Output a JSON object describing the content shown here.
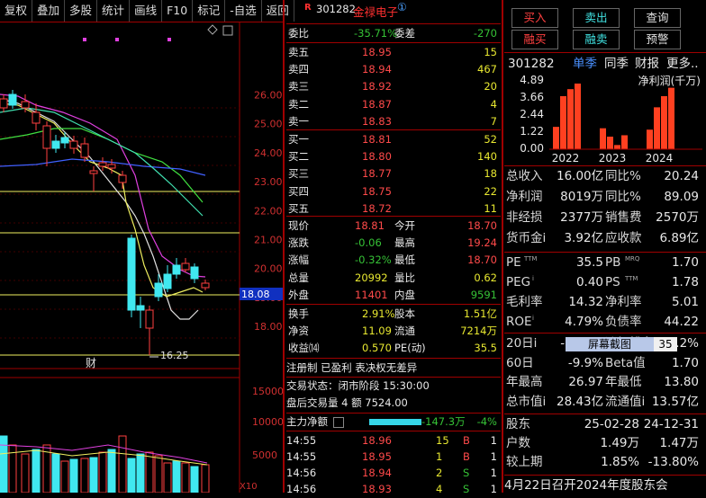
{
  "toolbar": {
    "items": [
      "复权",
      "叠加",
      "多股",
      "统计",
      "画线",
      "F10",
      "标记",
      "-自选",
      "返回"
    ]
  },
  "chart": {
    "y_ticks": [
      "26.00",
      "25.00",
      "24.00",
      "23.00",
      "22.00",
      "21.00",
      "20.00",
      "19.00",
      "18.00"
    ],
    "current_price_tag": "18.08",
    "low_label": "16.25",
    "finance_marker": "财",
    "volume_ticks": [
      "15000",
      "10000",
      "5000"
    ],
    "volume_unit": "X10"
  },
  "quote": {
    "badge": "R",
    "code": "301282",
    "name": "金禄电子",
    "info_icon": "①",
    "webi_label": "委比",
    "webi_value": "-35.71%",
    "weicha_label": "委差",
    "weicha_value": "-270",
    "asks": [
      {
        "label": "卖五",
        "price": "18.95",
        "vol": "15"
      },
      {
        "label": "卖四",
        "price": "18.94",
        "vol": "467"
      },
      {
        "label": "卖三",
        "price": "18.92",
        "vol": "20"
      },
      {
        "label": "卖二",
        "price": "18.87",
        "vol": "4"
      },
      {
        "label": "卖一",
        "price": "18.83",
        "vol": "7"
      }
    ],
    "bids": [
      {
        "label": "买一",
        "price": "18.81",
        "vol": "52"
      },
      {
        "label": "买二",
        "price": "18.80",
        "vol": "140"
      },
      {
        "label": "买三",
        "price": "18.77",
        "vol": "18"
      },
      {
        "label": "买四",
        "price": "18.75",
        "vol": "22"
      },
      {
        "label": "买五",
        "price": "18.72",
        "vol": "11"
      }
    ],
    "stats": [
      {
        "l1": "现价",
        "v1": "18.81",
        "l2": "今开",
        "v2": "18.70"
      },
      {
        "l1": "涨跌",
        "v1": "-0.06",
        "l2": "最高",
        "v2": "19.24"
      },
      {
        "l1": "涨幅",
        "v1": "-0.32%",
        "l2": "最低",
        "v2": "18.70"
      },
      {
        "l1": "总量",
        "v1": "20992",
        "l2": "量比",
        "v2": "0.62"
      },
      {
        "l1": "外盘",
        "v1": "11401",
        "l2": "内盘",
        "v2": "9591"
      }
    ],
    "stats2": [
      {
        "l1": "换手",
        "v1": "2.91%",
        "l2": "股本",
        "v2": "1.51亿"
      },
      {
        "l1": "净资",
        "v1": "11.09",
        "l2": "流通",
        "v2": "7214万"
      },
      {
        "l1": "收益⒁",
        "v1": "0.570",
        "l2": "PE(动)",
        "v2": "35.5"
      }
    ],
    "tags": "注册制 已盈利 表决权无差异",
    "trade_status": "交易状态：闭市阶段 15:30:00",
    "after_hours": "盘后交易量 4 额 7524.00",
    "main_flow_label": "主力净额",
    "main_flow_value": "-147.3万",
    "main_flow_pct": "-4%",
    "ticks": [
      {
        "time": "14:55",
        "price": "18.96",
        "vol": "15",
        "side": "B",
        "n": "1"
      },
      {
        "time": "14:55",
        "price": "18.95",
        "vol": "1",
        "side": "B",
        "n": "1"
      },
      {
        "time": "14:56",
        "price": "18.94",
        "vol": "2",
        "side": "S",
        "n": "1"
      },
      {
        "time": "14:56",
        "price": "18.93",
        "vol": "4",
        "side": "S",
        "n": "1"
      }
    ]
  },
  "right": {
    "buttons": [
      "买入",
      "卖出",
      "查询",
      "融买",
      "融卖",
      "预警"
    ],
    "code": "301282",
    "tabs": [
      "单季",
      "同季",
      "财报",
      "更多.."
    ],
    "chart_title": "净利润(千万)",
    "chart_data": {
      "type": "bar",
      "y_ticks": [
        "4.89",
        "3.66",
        "2.44",
        "1.22",
        "0.00"
      ],
      "ylim": [
        0,
        4.89
      ],
      "x_labels": [
        "2022",
        "2023",
        "2024"
      ],
      "values": [
        1.6,
        3.8,
        4.3,
        4.7,
        1.5,
        0.9,
        0.3,
        1.0,
        1.4,
        3.0,
        3.8,
        4.4
      ]
    },
    "metrics1": [
      {
        "l1": "总收入",
        "v1": "16.00亿",
        "l2": "同比%",
        "v2": "20.24"
      },
      {
        "l1": "净利润",
        "v1": "8019万",
        "l2": "同比%",
        "v2": "89.09"
      },
      {
        "l1": "非经损",
        "v1": "2377万",
        "l2": "销售费",
        "v2": "2570万"
      },
      {
        "l1": "货币金i",
        "v1": "3.92亿",
        "l2": "应收款",
        "v2": "6.89亿"
      }
    ],
    "metrics2": [
      {
        "l1": "PE",
        "sup1": "TTM",
        "v1": "35.5",
        "l2": "PB",
        "sup2": "MRQ",
        "v2": "1.70"
      },
      {
        "l1": "PEG",
        "sup1": "i",
        "v1": "0.40",
        "l2": "PS",
        "sup2": "TTM",
        "v2": "1.78"
      },
      {
        "l1": "毛利率",
        "sup1": "",
        "v1": "14.32",
        "l2": "净利率",
        "sup2": "",
        "v2": "5.01"
      },
      {
        "l1": "ROE",
        "sup1": "i",
        "v1": "4.79%",
        "l2": "负债率",
        "sup2": "",
        "v2": "44.22"
      }
    ],
    "perf": [
      {
        "l1": "20日i",
        "v1": "-23.9%",
        "l2": "涨幅排名",
        "v2": "-10.2%"
      },
      {
        "l1": "60日",
        "v1": "-9.9%",
        "l2": "Beta值",
        "v2": "1.70"
      },
      {
        "l1": "年最高",
        "v1": "26.97",
        "l2": "年最低",
        "v2": "13.80"
      },
      {
        "l1": "总市值i",
        "v1": "28.43亿",
        "l2": "流通值i",
        "v2": "13.57亿"
      }
    ],
    "screenshot_tip": "屏幕截图",
    "screenshot_num": "35",
    "holders": [
      {
        "l": "股东",
        "a": "25-02-28",
        "b": "24-12-31"
      },
      {
        "l": "户数",
        "a": "1.49万",
        "b": "1.47万"
      },
      {
        "l": "较上期",
        "a": "1.85%",
        "b": "-13.80%"
      }
    ],
    "notice": "4月22日召开2024年度股东会"
  }
}
